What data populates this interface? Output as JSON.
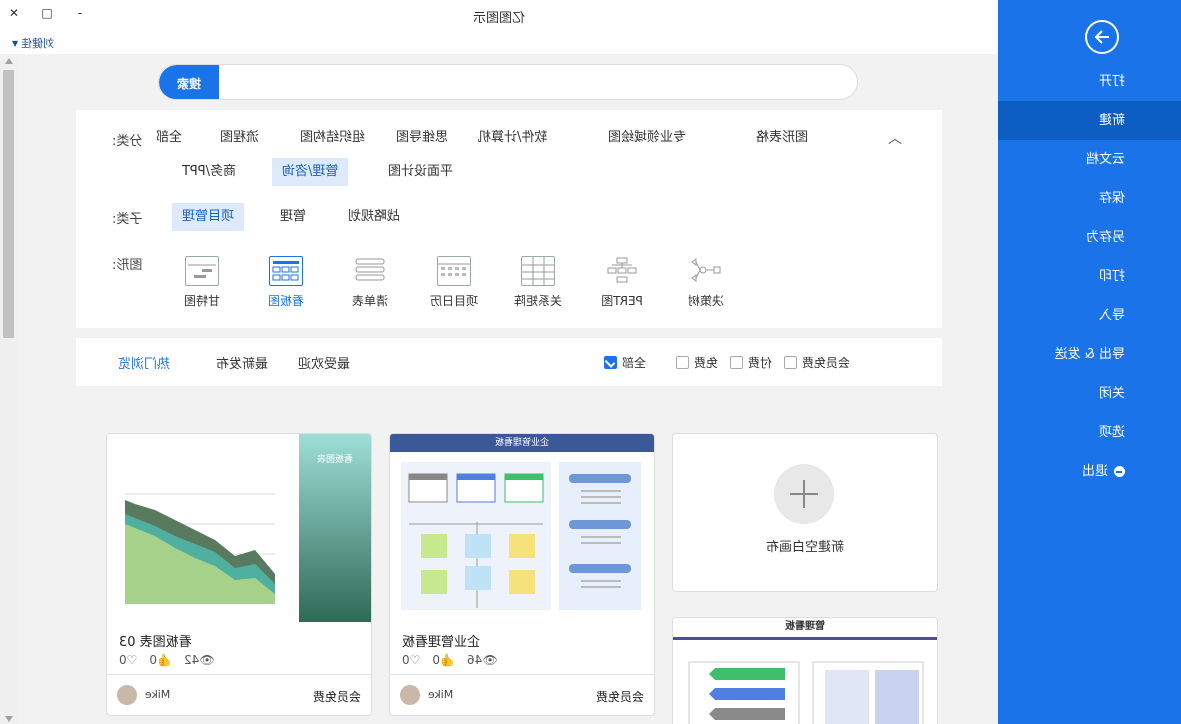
{
  "window": {
    "title": "亿图图示",
    "minimize": "-",
    "maximize": "□",
    "close": "✕"
  },
  "user": {
    "name": "刘健佳"
  },
  "sidebar": {
    "items": [
      {
        "label": "打开"
      },
      {
        "label": "新建",
        "active": true
      },
      {
        "label": "云文档"
      },
      {
        "label": "保存"
      },
      {
        "label": "另存为"
      },
      {
        "label": "打印"
      },
      {
        "label": "导入"
      },
      {
        "label": "导出 & 发送"
      },
      {
        "label": "关闭"
      },
      {
        "label": "选项"
      },
      {
        "label": "退出"
      }
    ]
  },
  "search": {
    "value": "",
    "placeholder": "",
    "button": "搜索"
  },
  "filters": {
    "category_label": "分类:",
    "categories": [
      "全部",
      "流程图",
      "组织结构图",
      "思维导图",
      "软件/计算机",
      "专业领域绘图",
      "图形表格",
      "商务/PPT",
      "管理/咨询",
      "平面设计图"
    ],
    "category_selected": "管理/咨询",
    "subcategory_label": "子类:",
    "subcategories": [
      "项目管理",
      "管理",
      "战略规划"
    ],
    "subcategory_selected": "项目管理",
    "shape_label": "图形:",
    "templates": [
      "甘特图",
      "看板图",
      "清单表",
      "项目日历",
      "关系矩阵",
      "PERT图",
      "决策树"
    ],
    "template_selected": "看板图"
  },
  "sortbar": {
    "sorts": [
      "热门浏览",
      "最新发布",
      "最受欢迎"
    ],
    "active": "热门浏览",
    "checkboxes": [
      {
        "label": "全部",
        "checked": true
      },
      {
        "label": "免费",
        "checked": false
      },
      {
        "label": "付费",
        "checked": false
      },
      {
        "label": "会员免费",
        "checked": false
      }
    ]
  },
  "new_blank": {
    "label": "新建空白画布"
  },
  "cards": [
    {
      "title": "企业管理看板",
      "header": "企业管理看板",
      "views": "46",
      "likes": "0",
      "favs": "0",
      "author": "Mike",
      "price": "会员免费"
    },
    {
      "title": "看板图表 03",
      "header": "看板图表",
      "views": "42",
      "likes": "0",
      "favs": "0",
      "author": "Mike",
      "price": "会员免费"
    },
    {
      "title": "管理看板",
      "header": "管理看板"
    }
  ],
  "colors": {
    "accent": "#1a73e8",
    "sidebar": "#1a73e8",
    "selected_chip": "#dceafb"
  }
}
